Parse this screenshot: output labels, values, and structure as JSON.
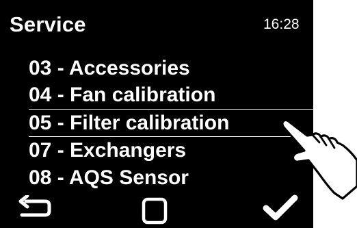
{
  "header": {
    "title": "Service",
    "time": "16:28"
  },
  "menu": {
    "items": [
      {
        "label": "03 - Accessories"
      },
      {
        "label": "04 - Fan calibration"
      },
      {
        "label": "05 - Filter calibration",
        "selected": true
      },
      {
        "label": "07 - Exchangers"
      },
      {
        "label": "08 - AQS Sensor"
      }
    ]
  },
  "softkeys": {
    "back": "back-arrow-icon",
    "home": "square-icon",
    "confirm": "checkmark-icon"
  },
  "colors": {
    "screen_bg": "#000000",
    "text": "#ffffff",
    "page_bg": "#ffffff"
  }
}
